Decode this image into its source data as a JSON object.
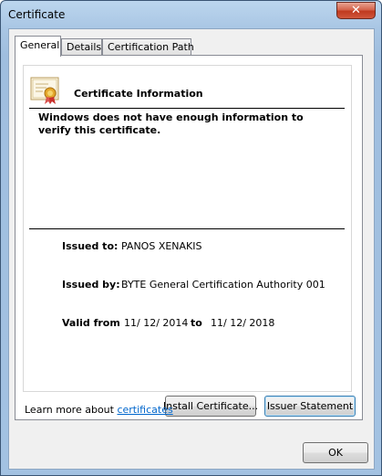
{
  "window": {
    "title": "Certificate",
    "close_glyph": "✕"
  },
  "tabs": [
    {
      "label": "General",
      "active": true
    },
    {
      "label": "Details",
      "active": false
    },
    {
      "label": "Certification Path",
      "active": false
    }
  ],
  "info": {
    "title": "Certificate Information",
    "warning": "Windows does not have enough information to verify this certificate."
  },
  "fields": {
    "issued_to_label": "Issued to:",
    "issued_to_value": "PANOS XENAKIS",
    "issued_by_label": "Issued by:",
    "issued_by_value": "BYTE General Certification Authority 001",
    "valid_from_label": "Valid from",
    "valid_from_value": "11/ 12/ 2014",
    "valid_to_label": "to",
    "valid_to_value": "11/ 12/ 2018"
  },
  "buttons": {
    "install": "Install Certificate...",
    "issuer_statement": "Issuer Statement",
    "ok": "OK"
  },
  "learn_more": {
    "prefix": "Learn more about ",
    "link": "certificates"
  },
  "colors": {
    "link": "#0066cc",
    "close_button": "#c0391f",
    "title_bar": "#a9c6e4"
  },
  "icons": [
    "certificate-icon",
    "close-icon"
  ]
}
